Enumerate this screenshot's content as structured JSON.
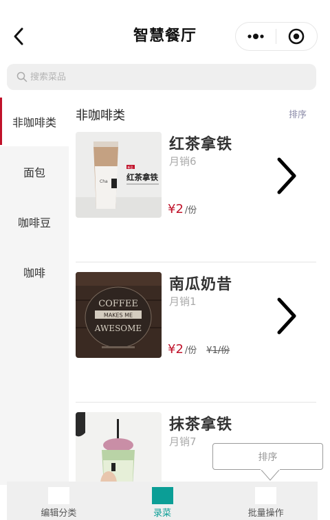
{
  "nav": {
    "title": "智慧餐厅",
    "back_icon": "chevron-left-icon",
    "more_icon": "more-dots-icon",
    "close_icon": "target-icon"
  },
  "search": {
    "placeholder": "搜索菜品",
    "icon": "search-icon"
  },
  "sidebar": {
    "items": [
      {
        "label": "非咖啡类",
        "active": true
      },
      {
        "label": "面包",
        "active": false
      },
      {
        "label": "咖啡豆",
        "active": false
      },
      {
        "label": "咖啡",
        "active": false
      }
    ]
  },
  "content": {
    "category_title": "非咖啡类",
    "sort_label": "排序",
    "products": [
      {
        "name": "红茶拿铁",
        "sales": "月销6",
        "price": "¥2",
        "unit": "/份",
        "original_price": "",
        "cup_label": "红茶拿铁",
        "cup_badge": "新品"
      },
      {
        "name": "南瓜奶昔",
        "sales": "月销1",
        "price": "¥2",
        "unit": "/份",
        "original_price": "¥1/份",
        "board_text": [
          "COFFEE",
          "MAKES ME",
          "AWESOME"
        ]
      },
      {
        "name": "抹茶拿铁",
        "sales": "月销7",
        "price": "",
        "unit": "",
        "original_price": ""
      }
    ]
  },
  "sort_popup": {
    "label": "排序"
  },
  "tabbar": {
    "tabs": [
      {
        "label": "编辑分类",
        "active": false
      },
      {
        "label": "录菜",
        "active": true
      },
      {
        "label": "批量操作",
        "active": false
      }
    ]
  },
  "colors": {
    "accent_red": "#c0122a",
    "teal": "#0b9e96"
  }
}
